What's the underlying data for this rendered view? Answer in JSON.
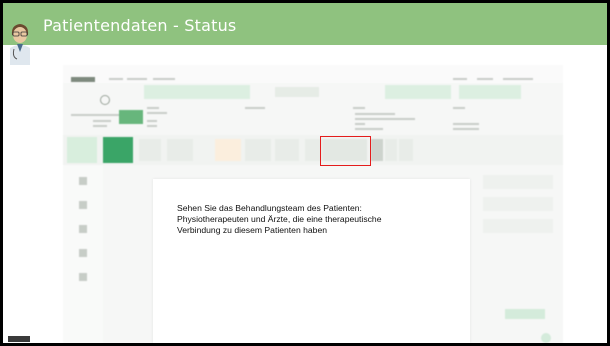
{
  "slide": {
    "title": "Patientendaten - Status",
    "caption_line1": "Sehen Sie das Behandlungsteam des Patienten:",
    "caption_line2": "Physiotherapeuten und Ärzte, die eine therapeutische",
    "caption_line3": "Verbindung zu diesem Patienten haben"
  },
  "colors": {
    "title_bar": "#8fc27f",
    "highlight": "#e41c1c",
    "accent": "#3aa567"
  },
  "icons": [
    "doctor-avatar-icon",
    "app-logo-icon",
    "patient-avatar-icon"
  ]
}
